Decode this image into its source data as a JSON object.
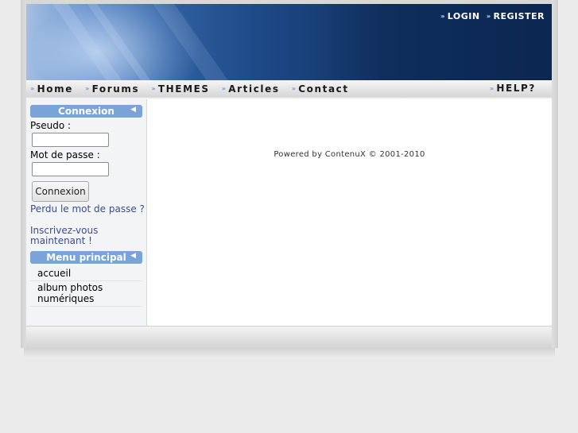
{
  "header": {
    "top_links": [
      {
        "label": "LOGIN"
      },
      {
        "label": "REGISTER"
      }
    ],
    "arrow_glyph": "›››"
  },
  "nav": {
    "items": [
      {
        "label": "Home"
      },
      {
        "label": "Forums"
      },
      {
        "label": "THEMES"
      },
      {
        "label": "Articles"
      },
      {
        "label": "Contact"
      }
    ],
    "help_label": "HELP?"
  },
  "sidebar": {
    "login_block": {
      "title": "Connexion",
      "username_label": "Pseudo :",
      "username_value": "",
      "password_label": "Mot de passe :",
      "password_value": "",
      "submit_label": "Connexion",
      "lost_password_link": "Perdu le mot de passe ?",
      "register_link": "Inscrivez-vous maintenant !"
    },
    "menu_block": {
      "title": "Menu principal",
      "items": [
        {
          "label": "accueil"
        },
        {
          "label": "album photos numériques"
        }
      ]
    }
  },
  "main": {
    "powered_by": "Powered by ContenuX © 2001-2010"
  },
  "colors": {
    "banner_dark": "#0b2751",
    "block_header": "#7aa3d8",
    "link": "#3a4d8c",
    "background": "#ebebeb"
  }
}
